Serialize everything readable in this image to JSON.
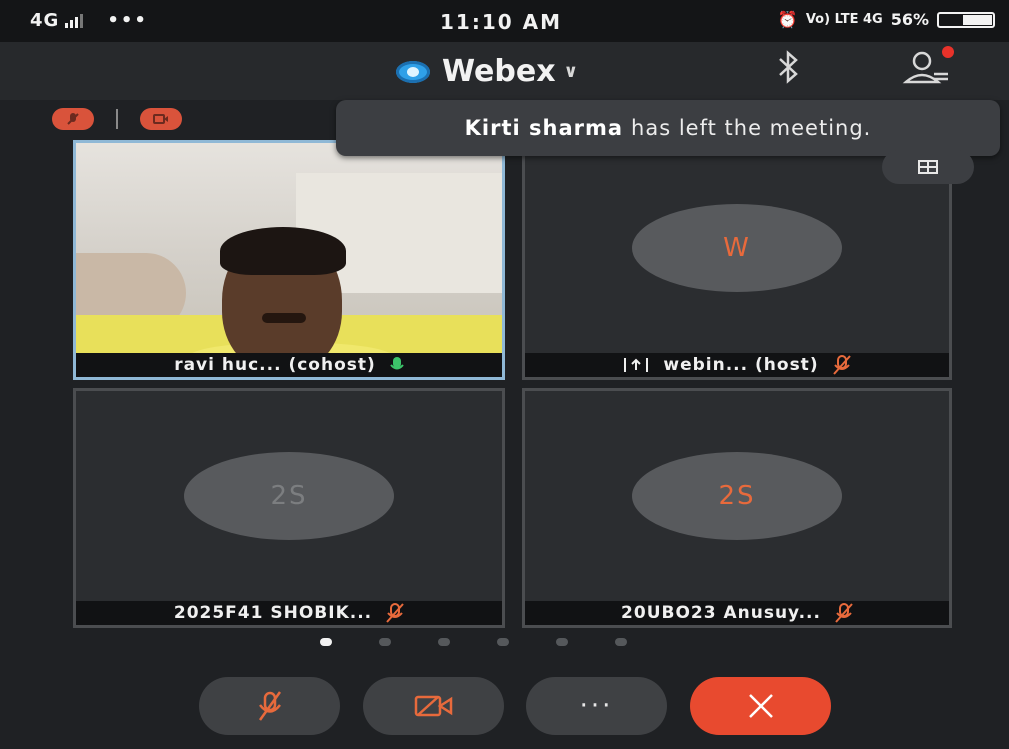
{
  "status_bar": {
    "network": "4G",
    "dots": "•••",
    "time": "11:10 AM",
    "right_text": "56%",
    "lte_text": "Vo) LTE 4G"
  },
  "top_bar": {
    "app_name": "Webex",
    "chevron": "∨"
  },
  "toast": {
    "name": "Kirti sharma",
    "message": "has left the meeting."
  },
  "tiles": [
    {
      "name_label": "ravi huc... (cohost)",
      "mic": "on",
      "video": true
    },
    {
      "name_label": "webin... (host)",
      "initials": "W",
      "mic": "muted",
      "initials_color": "#e86a3c",
      "sharing": true
    },
    {
      "name_label": "2025F41 SHOBIK...",
      "initials": "2S",
      "mic": "muted",
      "initials_color": "#7c7e80"
    },
    {
      "name_label": "20UBO23 Anusuy...",
      "initials": "2S",
      "mic": "muted",
      "initials_color": "#e86a3c"
    }
  ],
  "page_indicator": {
    "pages": 6,
    "current": 1
  },
  "controls": {
    "more_label": "···"
  },
  "colors": {
    "accent_orange": "#e86a3c",
    "end_red": "#e84a2f",
    "webex_blue": "#2fa0e8",
    "mic_green": "#3cc46a"
  },
  "icons": {
    "bluetooth": "bluetooth-icon",
    "participants": "participants-icon",
    "layout": "grid-layout-icon",
    "mute": "microphone-muted-icon",
    "video": "video-off-icon",
    "more": "more-icon",
    "end": "end-call-icon"
  }
}
